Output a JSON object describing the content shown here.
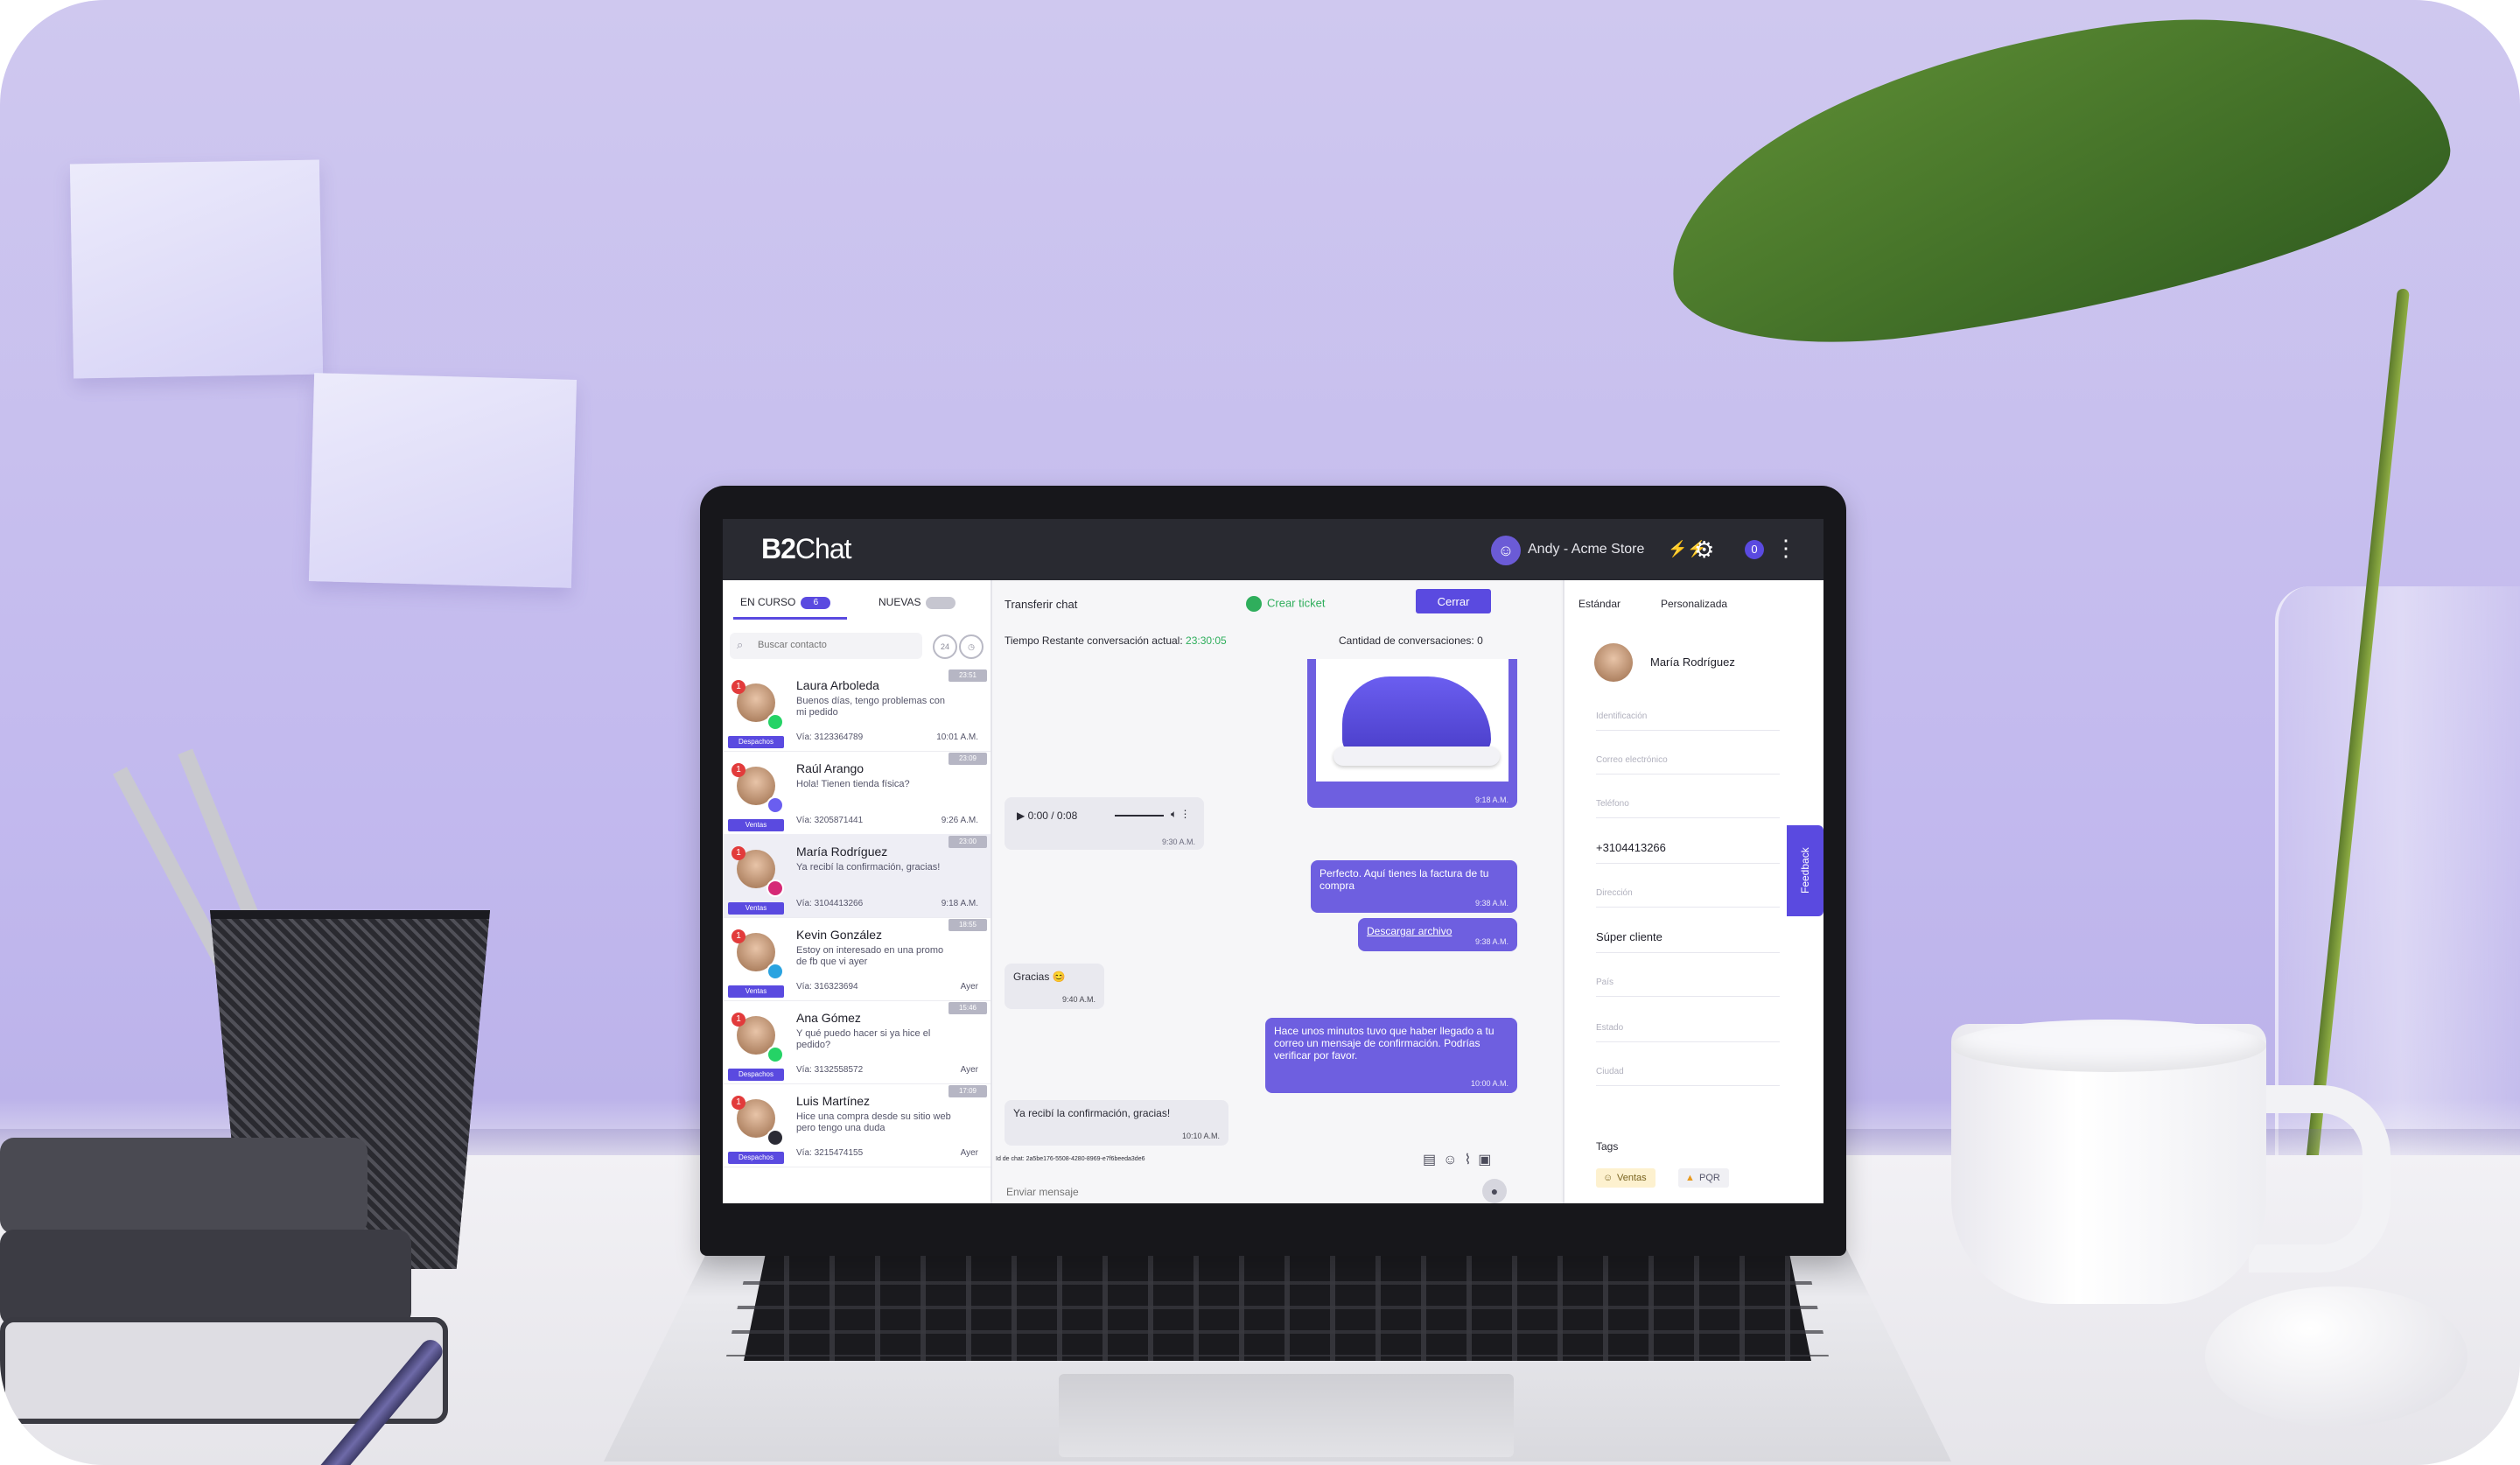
{
  "app": {
    "logo_bold": "B2",
    "logo_light": "Chat"
  },
  "header": {
    "agent_name": "Andy - Acme Store",
    "notification_count": "0"
  },
  "left_panel": {
    "tabs": [
      {
        "label": "EN CURSO",
        "count": "6"
      },
      {
        "label": "NUEVAS",
        "count": ""
      }
    ],
    "search_placeholder": "Buscar contacto",
    "contacts": [
      {
        "name": "Laura Arboleda",
        "message": "Buenos días, tengo problemas con mi pedido",
        "via": "Vía: 3123364789",
        "time": "10:01 A.M.",
        "tag": "Despachos",
        "timer": "23:51"
      },
      {
        "name": "Raúl Arango",
        "message": "Hola! Tienen tienda física?",
        "via": "Vía: 3205871441",
        "time": "9:26 A.M.",
        "tag": "Ventas",
        "timer": "23:09"
      },
      {
        "name": "María Rodríguez",
        "message": "Ya recibí la confirmación, gracias!",
        "via": "Vía: 3104413266",
        "time": "9:18 A.M.",
        "tag": "Ventas",
        "timer": "23:00"
      },
      {
        "name": "Kevin González",
        "message": "Estoy on interesado en una promo de fb que vi ayer",
        "via": "Vía: 316323694",
        "time": "Ayer",
        "tag": "Ventas",
        "timer": "18:55"
      },
      {
        "name": "Ana Gómez",
        "message": "Y qué puedo hacer si ya hice el pedido?",
        "via": "Vía: 3132558572",
        "time": "Ayer",
        "tag": "Despachos",
        "timer": "15:46"
      },
      {
        "name": "Luis Martínez",
        "message": "Hice una compra desde su sitio web pero tengo una duda",
        "via": "Vía: 3215474155",
        "time": "Ayer",
        "tag": "Despachos",
        "timer": "17:09"
      }
    ]
  },
  "chat": {
    "transfer_label": "Transferir chat",
    "create_ticket": "Crear ticket",
    "close_button": "Cerrar",
    "timer_label": "Tiempo Restante conversación actual:",
    "timer_value": "23:30:05",
    "count_label": "Cantidad de conversaciones: 0",
    "image_time": "9:18 A.M.",
    "audio": {
      "time": "0:00 / 0:08",
      "stamp": "9:30 A.M."
    },
    "messages": [
      {
        "text": "Perfecto. Aquí tienes la factura de tu compra",
        "time": "9:38 A.M."
      },
      {
        "text": "Descargar archivo",
        "time": "9:38 A.M."
      },
      {
        "text": "Gracias 😊",
        "time": "9:40 A.M."
      },
      {
        "text": "Hace unos minutos tuvo que haber llegado a tu correo un mensaje de confirmación. Podrías verificar por favor.",
        "time": "10:00 A.M."
      },
      {
        "text": "Ya recibí la confirmación, gracias!",
        "time": "10:10 A.M."
      }
    ],
    "chat_id": "Id de chat: 2a5be176-5508-4280-8969-e7f6beeda3de6",
    "compose_placeholder": "Enviar mensaje"
  },
  "right_panel": {
    "tabs": [
      "Estándar",
      "Personalizada"
    ],
    "contact_name": "María Rodríguez",
    "fields": [
      {
        "label": "Identificación",
        "value": ""
      },
      {
        "label": "Correo electrónico",
        "value": ""
      },
      {
        "label": "Teléfono",
        "value": ""
      },
      {
        "label": "",
        "value": "+3104413266"
      },
      {
        "label": "Dirección",
        "value": ""
      },
      {
        "label": "",
        "value": "Súper cliente"
      },
      {
        "label": "País",
        "value": ""
      },
      {
        "label": "Estado",
        "value": ""
      },
      {
        "label": "Ciudad",
        "value": ""
      }
    ],
    "tags_label": "Tags",
    "tags": [
      "Ventas",
      "PQR"
    ],
    "feedback": "Feedback"
  },
  "colors": {
    "accent": "#5a4ae0",
    "topbar": "#292a31",
    "success": "#2fae5c",
    "wall": "#c2b9ee"
  }
}
